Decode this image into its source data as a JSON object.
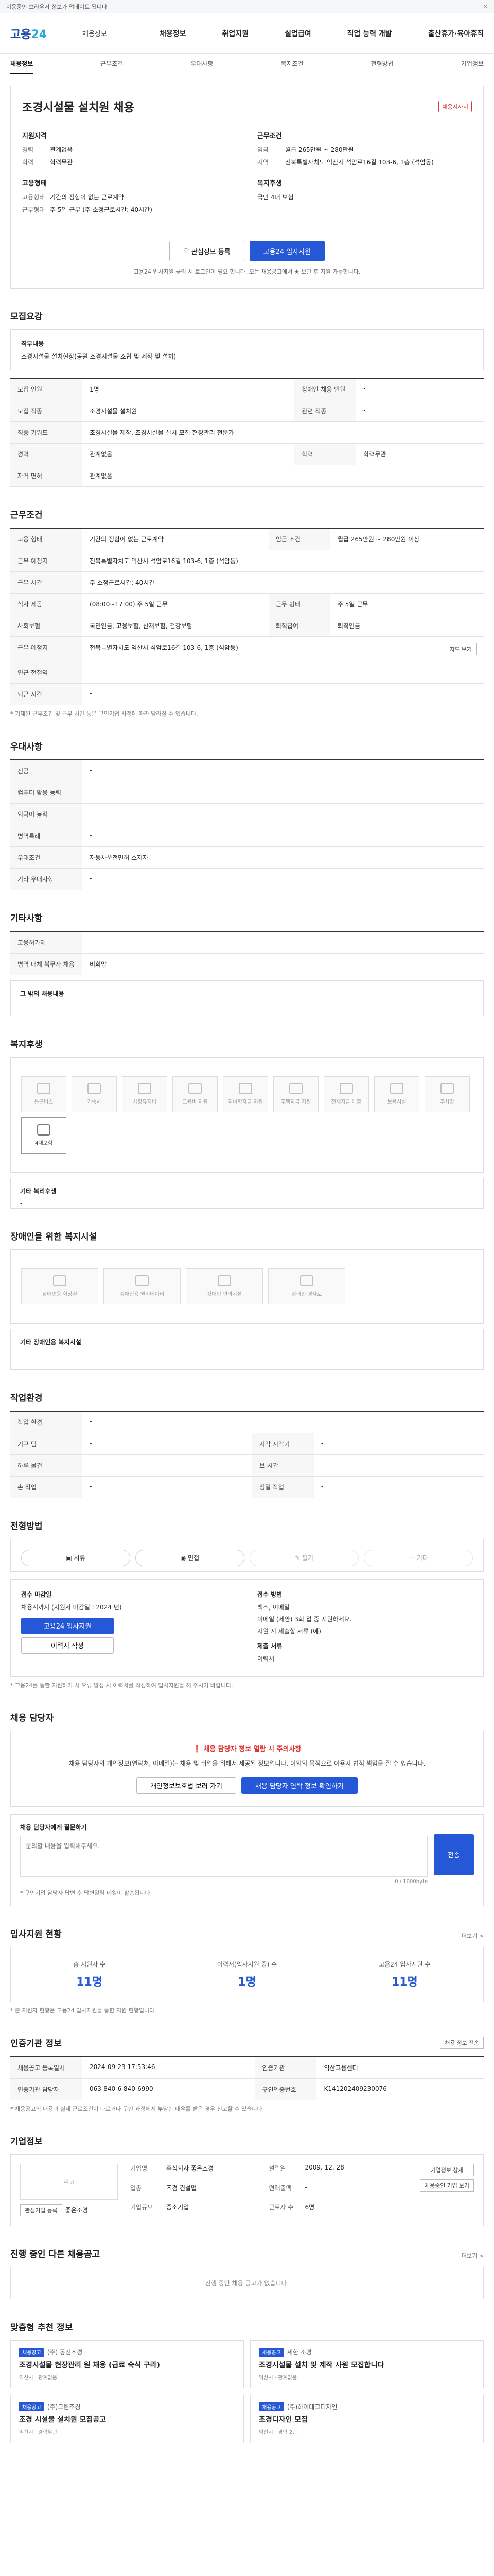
{
  "topbar": {
    "text": "이용중인 브라우저 정보가 업데이트 됩니다"
  },
  "header": {
    "logo_main": "고용",
    "logo_sub": "24",
    "search_placeholder": "채용정보"
  },
  "gnb": [
    "채용정보",
    "취업지원",
    "실업급여",
    "직업 능력 개발",
    "출산휴가·육아휴직"
  ],
  "subnav": [
    "채용정보",
    "근무조건",
    "우대사항",
    "복지조건",
    "전형방법",
    "기업정보"
  ],
  "job": {
    "title": "조경시설물 설치원 채용",
    "badge": "채용시까지",
    "company_title": "지원자격",
    "rows1": [
      {
        "k": "경력",
        "v": "관계없음"
      },
      {
        "k": "학력",
        "v": "학력무관"
      }
    ],
    "cond_title": "근무조건",
    "rows2": [
      {
        "k": "임금",
        "v": "월급 265만원 ~ 280만원"
      },
      {
        "k": "지역",
        "v": "전북특별자치도 익산시 석암로16길 103-6, 1층 (석암동)"
      }
    ],
    "type_title": "고용형태",
    "rows3": [
      {
        "k": "고용형태",
        "v": "기간의 정함이 없는 근로계약"
      },
      {
        "k": "근무형태",
        "v": "주 5일 근무 (주 소정근로시간: 40시간)"
      }
    ],
    "welfare_title": "복지후생",
    "rows4": [
      {
        "k": "",
        "v": "국민 4대 보험"
      }
    ],
    "btn_like": "관심정보 등록",
    "btn_apply": "고용24 입사지원",
    "note": "고용24 입사지원 클릭 시 로그인이 필요 합니다. 모든 채용공고에서 ★ 보관 후 지원 가능합니다."
  },
  "recruit": {
    "title": "모집요강",
    "job_box_title": "직무내용",
    "job_box_text": "조경시설물 설치현장(공원 조경시설물 조립 및 제작 및 설치)",
    "rows": [
      {
        "k": "모집 인원",
        "v": "1명",
        "k2": "장애인 채용 인원",
        "v2": "-"
      },
      {
        "k": "모집 직종",
        "v": "조경시설물 설치원",
        "k2": "관련 직종",
        "v2": "-"
      },
      {
        "k": "직종 키워드",
        "v": "조경시설물 제작, 조경시설물 설치 모집 현장관리 전문가",
        "k2": "",
        "v2": ""
      },
      {
        "k": "경력",
        "v": "관계없음",
        "k2": "학력",
        "v2": "학력무관"
      },
      {
        "k": "자격 면허",
        "v": "관계없음",
        "k2": "",
        "v2": ""
      }
    ]
  },
  "work": {
    "title": "근무조건",
    "rows": [
      {
        "k": "고용 형태",
        "v": "기간의 정함이 없는 근로계약",
        "k2": "임금 조건",
        "v2": "월급 265만원 ~ 280만원 이상"
      },
      {
        "k": "근무 예정지",
        "v": "전북특별자치도 익산시 석암로16길 103-6, 1층 (석암동)",
        "k2": "",
        "v2": ""
      },
      {
        "k": "근무 시간",
        "v": "주 소정근로시간: 40시간",
        "k2": "",
        "v2": ""
      },
      {
        "k": "식사 제공",
        "v": "(08:00~17:00) 주 5일 근무",
        "k2": "근무 형태",
        "v2": "주 5일 근무"
      },
      {
        "k": "사회보험",
        "v": "국민연금, 고용보험, 산재보험, 건강보험",
        "k2": "퇴직급여",
        "v2": "퇴직연금"
      },
      {
        "k": "근무 예정지",
        "v": "전북특별자치도 익산시 석암로16길 103-6, 1층 (석암동)",
        "k2": "",
        "v2": ""
      },
      {
        "k": "인근 전철역",
        "v": "-",
        "k2": "",
        "v2": ""
      },
      {
        "k": "퇴근 시간",
        "v": "-",
        "k2": "",
        "v2": ""
      }
    ],
    "map_btn": "지도 보기",
    "foot": "* 기재된 근무조건 및 근무 시간 등은 구인기업 사정에 따라 달라질 수 있습니다."
  },
  "prefer": {
    "title": "우대사항",
    "rows": [
      {
        "k": "전공",
        "v": "-"
      },
      {
        "k": "컴퓨터 활용 능력",
        "v": "-"
      },
      {
        "k": "외국어 능력",
        "v": "-"
      },
      {
        "k": "병역특례",
        "v": "-"
      },
      {
        "k": "우대조건",
        "v": "자동차운전면허 소지자"
      },
      {
        "k": "기타 우대사항",
        "v": "-"
      }
    ]
  },
  "etc": {
    "title": "기타사항",
    "rows": [
      {
        "k": "고용허가제",
        "v": "-"
      },
      {
        "k": "병역 대체 복무자 채용",
        "v": "비희망"
      }
    ],
    "box_title": "그 밖의 채용내용",
    "box_text": "-"
  },
  "welfare": {
    "title": "복지후생",
    "items": [
      {
        "label": "통근버스",
        "on": false
      },
      {
        "label": "기숙사",
        "on": false
      },
      {
        "label": "차량유지비",
        "on": false
      },
      {
        "label": "교육비 지원",
        "on": false
      },
      {
        "label": "자녀학자금 지원",
        "on": false
      },
      {
        "label": "주택자금 지원",
        "on": false
      },
      {
        "label": "전세자금 대출",
        "on": false
      },
      {
        "label": "보육시설",
        "on": false
      },
      {
        "label": "주차장",
        "on": false
      },
      {
        "label": "4대보험",
        "on": true
      }
    ],
    "box_title": "기타 복리후생",
    "box_text": "-"
  },
  "disability": {
    "title": "장애인을 위한 복지시설",
    "items": [
      "장애인용 화장실",
      "장애인용 엘리베이터",
      "장애인 편의시설",
      "장애인 경사로"
    ],
    "box_title": "기타 장애인용 복지시설",
    "box_text": "-"
  },
  "env": {
    "title": "작업환경",
    "rows": [
      {
        "k": "작업 환경",
        "v": "-",
        "k2": "",
        "v2": ""
      },
      {
        "k": "기구 팀",
        "v": "-",
        "k2": "시각 시각기",
        "v2": "-"
      },
      {
        "k": "하루 물건",
        "v": "-",
        "k2": "보 시간",
        "v2": "-"
      },
      {
        "k": "손 작업",
        "v": "-",
        "k2": "정밀 작업",
        "v2": "-"
      }
    ]
  },
  "process": {
    "title": "전형방법",
    "steps": [
      {
        "label": "서류",
        "on": true
      },
      {
        "label": "면접",
        "on": true
      },
      {
        "label": "필기",
        "on": false
      },
      {
        "label": "기타",
        "on": false
      }
    ],
    "apply_title": "접수 마감일",
    "apply_lines": [
      "채용시까지 (지원서 마감일 : 2024 년)"
    ],
    "apply_btn": "고용24 입사지원",
    "detail_btn": "이력서 작성",
    "right_title": "접수 방법",
    "right_lines": [
      "팩스, 이메일",
      "이메일 (제안) 3회 접 중 지원하세요.",
      "지원 시 제출할 서류 (예)"
    ],
    "docs_title": "제출 서류",
    "docs_text": "이력서",
    "notice": "* 고용24를 통한 지원하기 시 오류 발생 시 이력서를 작성하여 입사지원을 해 주시기 바랍니다."
  },
  "contact": {
    "title": "채용 담당자",
    "notice_head": "채용 담당자 정보 열람 시 주의사항",
    "notice_p": "채용 담당자의 개인정보(연락처, 이메일)는 채용 및 취업을 위해서 제공된 정보입니다. 이외의 목적으로 이용시 법적 책임을 질 수 있습니다.",
    "btn1": "개인정보보호법 보러 가기",
    "btn2": "채용 담당자 연락 정보 확인하기",
    "qa_title": "채용 담당자에게 질문하기",
    "qa_placeholder": "문의할 내용을 입력해주세요.",
    "qa_count": "0 / 1000byte",
    "qa_btn": "전송",
    "qa_note": "* 구인기업 담당자 답변 후 답변알림 메일이 발송됩니다."
  },
  "stats": {
    "title": "입사지원 현황",
    "more": "더보기 >",
    "items": [
      {
        "label": "총 지원자 수",
        "num": "11명"
      },
      {
        "label": "이력서(입사지원 중) 수",
        "num": "1명"
      },
      {
        "label": "고용24 입사지원 수",
        "num": "11명"
      }
    ],
    "foot": "* 본 지원자 현황은 고용24 입사지원을 통한 지원 현황입니다."
  },
  "info": {
    "title": "인증기관 정보",
    "rows": [
      {
        "k": "채용공고 등록일시",
        "v": "2024-09-23 17:53:46",
        "k2": "인증기관",
        "v2": "익산고용센터"
      },
      {
        "k": "인증기관 담당자",
        "v": "063-840-6 840-6990",
        "k2": "구인인증번호",
        "v2": "K141202409230076"
      }
    ],
    "btn": "채용 정보 전송",
    "foot": "* 채용공고의 내용과 실제 근로조건이 다르거나 구인 과정에서 부당한 대우를 받은 경우 신고할 수 있습니다."
  },
  "company": {
    "title": "기업정보",
    "logo": "로고",
    "name": "좋은조경",
    "rows": [
      {
        "k": "기업명",
        "v": "주식회사 좋은조경"
      },
      {
        "k": "업종",
        "v": "조경 건설업"
      },
      {
        "k": "기업규모",
        "v": "중소기업"
      },
      {
        "k": "설립일",
        "v": "2009. 12. 28"
      },
      {
        "k": "연매출액",
        "v": "-"
      },
      {
        "k": "근로자 수",
        "v": "6명"
      }
    ],
    "btn1": "기업정보 상세",
    "btn2": "채용중인 기업 보기",
    "btn_like": "관심기업 등록"
  },
  "other": {
    "title": "진행 중인 다른 채용공고",
    "more": "더보기 >",
    "empty": "진행 중인 채용 공고가 없습니다."
  },
  "recommend": {
    "title": "맞춤형 추천 정보",
    "cards": [
      {
        "cat": "채용공고",
        "org": "(주) 동진조경",
        "tt": "조경시설물 현장관리 원 채용 (급료 숙식 구라)",
        "tags": "익산시 · 관계없음"
      },
      {
        "cat": "채용공고",
        "org": "세한 조경",
        "tt": "조경시설물 설치 및 제작 사원 모집합니다",
        "tags": "익산시 · 관계없음"
      },
      {
        "cat": "채용공고",
        "org": "(주)그린조경",
        "tt": "조경 시설물 설치원 모집공고",
        "tags": "익산시 · 경력무관"
      },
      {
        "cat": "채용공고",
        "org": "(주)하이테크디자인",
        "tt": "조경디자인 모집",
        "tags": "익산시 · 경력 2년"
      }
    ]
  },
  "colors": {
    "accent": "#2458d6",
    "warning": "#d33333"
  }
}
